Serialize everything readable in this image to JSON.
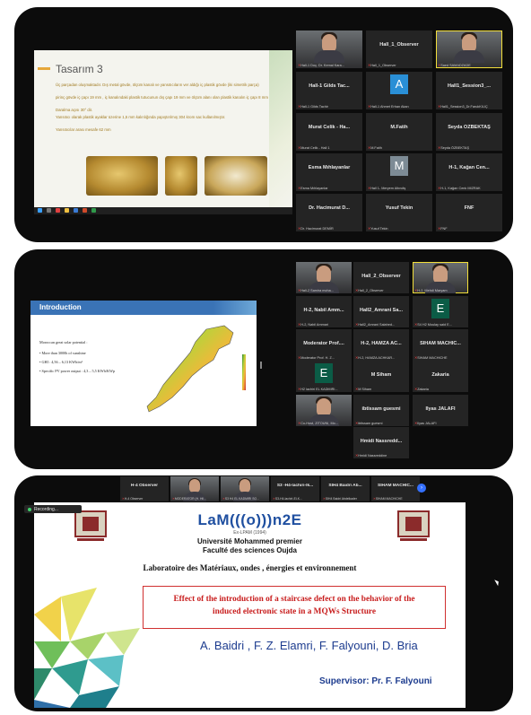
{
  "panel1": {
    "slide": {
      "title": "Tasarım 3",
      "bullets": [
        "Üç parçadan oluşmaktadır. Dış metal gövde, ölçüm kanalı ve yansıtıcıların ver aldığı iç plastik gövde (iki simetrik parça)",
        "pirinç gövde iç çapı 19 mm , iç kanalındaki plastik tutucunun dış çapı 19 mm ve ölçüm alanı olan plastik kanalın iç çapı 8 mm",
        "Daralma açısı 30° dir.",
        "Yansıtıcı olarak plastik ayaklar üzerine 1,5 mm kalınlığında yapıştırılmış 304 krom sac kullanılmıştır.",
        "Yansıtıcılar arası mesafe 62 mm"
      ]
    },
    "tiles": [
      {
        "name": "",
        "label": "Hall-1 Doç. Dr. Kemal Kara...",
        "video": true,
        "hl": false
      },
      {
        "name": "Hall_1_Observer",
        "label": "Hall_1_Observer"
      },
      {
        "name": "",
        "label": "Saed SAMADZADE",
        "video": true,
        "hl": true
      },
      {
        "name": "Hall-1 Gilds Tac...",
        "label": "Hall-1 Gilds Tachir"
      },
      {
        "name": "",
        "label": "Hall-1 Ahmet Erhan Akan",
        "avatar": "A",
        "avatar_color": "#2a8fd6"
      },
      {
        "name": "Hall1_Session3_...",
        "label": "Hall1_Session3_Dr.FarukKILIÇ"
      },
      {
        "name": "Murat Celik - Ha...",
        "label": "Murat Celik - Hall 1"
      },
      {
        "name": "M.Fatih",
        "label": "M.Fatih"
      },
      {
        "name": "Seyda ÖZBEKTAŞ",
        "label": "Seyda ÖZBEKTAŞ"
      },
      {
        "name": "Esma Mıhlayanlar",
        "label": "Esma Mıhlayanlar"
      },
      {
        "name": "",
        "label": "Hall 1- Meryem Altındiş",
        "avatar": "M",
        "avatar_color": "#7d8b95"
      },
      {
        "name": "H-1, Kağan Cen...",
        "label": "H-1, Kağan Cenk MIZRAK"
      },
      {
        "name": "Dr. Hacimurat D...",
        "label": "Dr. Hacimurat DEMİR"
      },
      {
        "name": "Yusuf Tekin",
        "label": "Yusuf Tekin"
      },
      {
        "name": "FNF",
        "label": "FNF"
      }
    ]
  },
  "panel2": {
    "slide": {
      "title": "Introduction",
      "lines": [
        "Moroccan great solar potential :",
        "•  More than 3000h of sunshine",
        "•  GHI : 4,56 – 6,13 KWh/m²",
        "•  Specific PV power output : 4,3 – 5,5 KWh/KWp"
      ]
    },
    "tiles": [
      {
        "name": "",
        "label": "Hall-2 Samira moha...",
        "video": true
      },
      {
        "name": "Hall_2_Observer",
        "label": "Hall_2_Observer"
      },
      {
        "name": "",
        "label": "H-2, Mehdi Maryam",
        "video": true,
        "hl": true
      },
      {
        "name": "H-2, Nabil Amm...",
        "label": "H-2, Nabil Ammari"
      },
      {
        "name": "Hall2_Amrani Sa...",
        "label": "Hall2_Amrani Salahed..."
      },
      {
        "name": "",
        "label": "S4 H2 Moulay said E...",
        "avatar": "E",
        "avatar_color": "#0b5c46"
      },
      {
        "name": "Moderator Prof....",
        "label": "Moderator Prof. H. Z..."
      },
      {
        "name": "H-2, HAMZA AC...",
        "label": "H-2, HAMZA ACHKAR..."
      },
      {
        "name": "SIHAM MACHIC...",
        "label": "SIHAM MACHICHE"
      },
      {
        "name": "",
        "label": "H2 lachiri EL KADMIRI...",
        "avatar": "E",
        "avatar_color": "#0b5c46"
      },
      {
        "name": "M Siham",
        "label": "M Siham"
      },
      {
        "name": "Zakaria",
        "label": "Zakaria"
      },
      {
        "name": "",
        "label": "Co-Host, ZITOUNI, Mo...",
        "video": true
      },
      {
        "name": "ibtissam guesmi",
        "label": "ibtissam guesmi"
      },
      {
        "name": "Ilyas JALAFI",
        "label": "Ilyas JALAFI"
      },
      {
        "name": "Hmidi Nassredd...",
        "label": "Hmidi Nassreddine"
      }
    ]
  },
  "panel3": {
    "topstrip": [
      {
        "name": "H-4 Observer",
        "label": "H-4 Observer"
      },
      {
        "name": "",
        "label": "MODERATOR (H. Hil...",
        "video": true
      },
      {
        "name": "",
        "label": "S3 H4 EL KADMIRI SO...",
        "video": true
      },
      {
        "name": "S3 -H4-lachiri-lk...",
        "label": "S3-H4-lachiri-El-K..."
      },
      {
        "name": "SIH4 Baidri Ab...",
        "label": "SIH4 Baidri Abdelkader"
      },
      {
        "name": "SIHAM MACHIC...",
        "label": "SIHAM MACHICHE"
      }
    ],
    "recording": "Recording...",
    "slide": {
      "logo": "LaM(((o)))n2E",
      "logo_sub": "Ex-LPAM (1994)",
      "university": "Université Mohammed premier",
      "faculty": "Faculté des sciences Oujda",
      "lab": "Laboratoire  des Matériaux, ondes , énergies et environnement",
      "title_line1": "Effect of the introduction of a staircase defect on the behavior of the",
      "title_line2": "induced electronic state in a MQWs Structure",
      "authors": "A. Baidri , F. Z. Elamri, F. Falyouni, D. Bria",
      "supervisor": "Supervisor: Pr. F. Falyouni"
    }
  },
  "colors": {
    "host_highlight": "#f2de3a",
    "zoom_blue": "#3470ff",
    "slide_blue": "#3a73b6",
    "title_red": "#c81d1d"
  }
}
